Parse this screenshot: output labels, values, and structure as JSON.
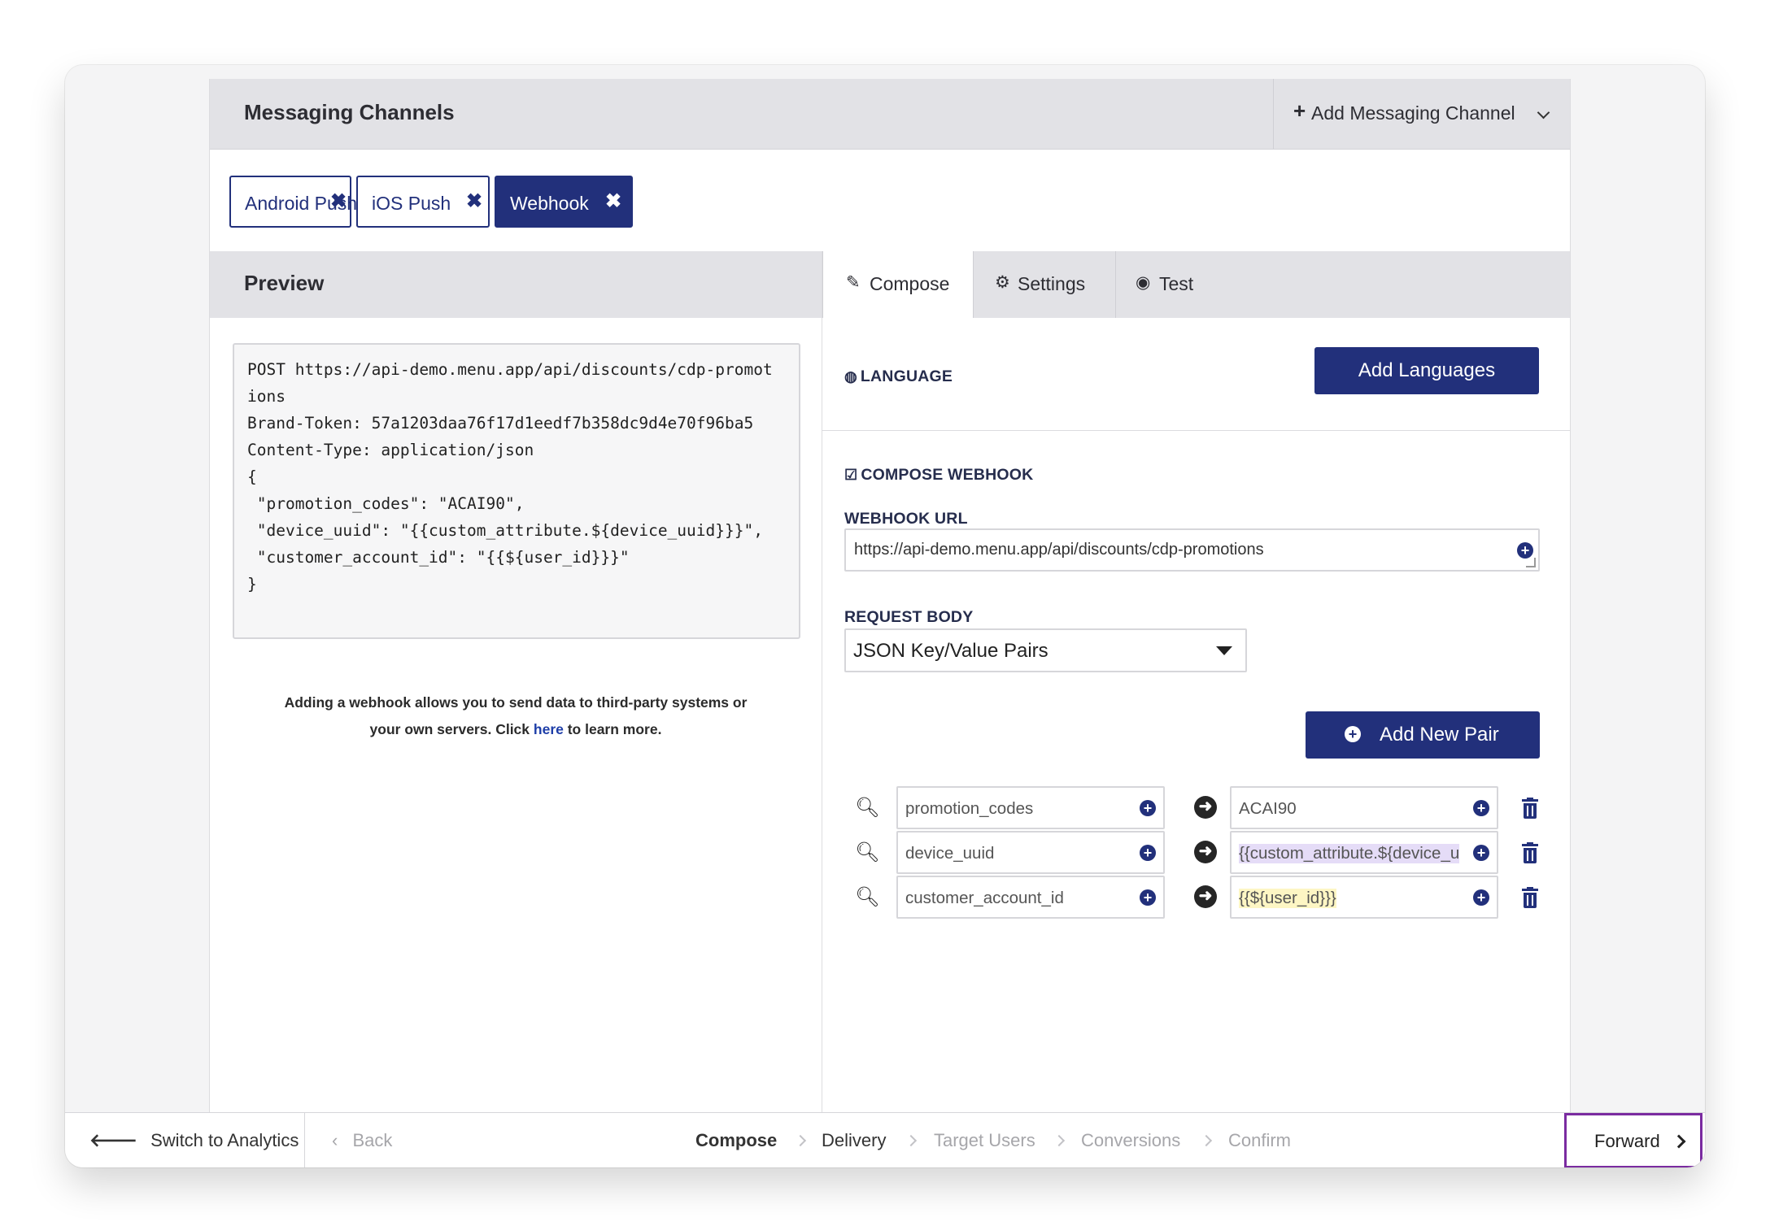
{
  "messaging_channels": {
    "title": "Messaging Channels",
    "add_channel_label": "Add Messaging Channel",
    "chips": [
      {
        "label": "Android Push",
        "active": false
      },
      {
        "label": "iOS Push",
        "active": false
      },
      {
        "label": "Webhook",
        "active": true
      }
    ]
  },
  "preview": {
    "title": "Preview",
    "code": "POST https://api-demo.menu.app/api/discounts/cdp-promot\nions\nBrand-Token: 57a1203daa76f17d1eedf7b358dc9d4e70f96ba5\nContent-Type: application/json\n{\n \"promotion_codes\": \"ACAI90\",\n \"device_uuid\": \"{{custom_attribute.${device_uuid}}}\",\n \"customer_account_id\": \"{{${user_id}}}\"\n}",
    "note_line1": "Adding a webhook allows you to send data to third-party systems or",
    "note_line2_a": "your own servers. Click ",
    "note_link": "here",
    "note_line2_b": " to learn more."
  },
  "tabs": [
    {
      "label": "Compose",
      "icon": "pencil-icon",
      "active": true
    },
    {
      "label": "Settings",
      "icon": "gear-icon",
      "active": false
    },
    {
      "label": "Test",
      "icon": "eye-icon",
      "active": false
    }
  ],
  "language": {
    "label": "LANGUAGE",
    "button": "Add Languages"
  },
  "compose": {
    "section_label": "COMPOSE WEBHOOK",
    "url_label": "WEBHOOK URL",
    "url_value": "https://api-demo.menu.app/api/discounts/cdp-promotions",
    "body_label": "REQUEST BODY",
    "body_type": "JSON Key/Value Pairs",
    "add_pair_button": "Add New Pair",
    "pairs": [
      {
        "key": "promotion_codes",
        "value": "ACAI90"
      },
      {
        "key": "device_uuid",
        "value": "{{custom_attribute.${device_u"
      },
      {
        "key": "customer_account_id",
        "value": "{{${user_id}}}"
      }
    ]
  },
  "footer": {
    "switch_label": "Switch to Analytics",
    "back_label": "Back",
    "steps": [
      "Compose",
      "Delivery",
      "Target Users",
      "Conversions",
      "Confirm"
    ],
    "forward_label": "Forward"
  },
  "colors": {
    "accent": "#22307b",
    "forward_outline": "#7a2ba0"
  }
}
